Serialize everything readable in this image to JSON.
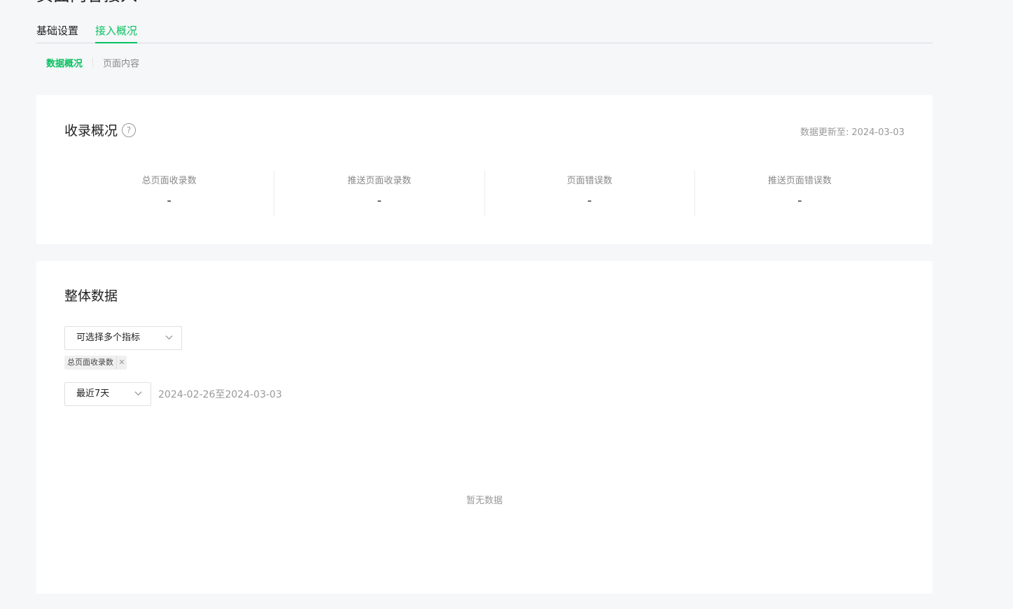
{
  "page": {
    "heading": "页面内容接入"
  },
  "tabs": [
    {
      "label": "基础设置",
      "active": false
    },
    {
      "label": "接入概况",
      "active": true
    }
  ],
  "subtabs": [
    {
      "label": "数据概况",
      "active": true
    },
    {
      "label": "页面内容",
      "active": false
    }
  ],
  "overview": {
    "title": "收录概况",
    "help_icon": "question-circle-icon",
    "update_info": "数据更新至: 2024-03-03",
    "stats": [
      {
        "label": "总页面收录数",
        "value": "-"
      },
      {
        "label": "推送页面收录数",
        "value": "-"
      },
      {
        "label": "页面错误数",
        "value": "-"
      },
      {
        "label": "推送页面错误数",
        "value": "-"
      }
    ]
  },
  "data_section": {
    "title": "整体数据",
    "metric_select": {
      "value": "可选择多个指标"
    },
    "selected_tags": [
      {
        "label": "总页面收录数"
      }
    ],
    "period_select": {
      "value": "最近7天"
    },
    "date_range": "2024-02-26至2024-03-03",
    "empty_text": "暂无数据"
  },
  "colors": {
    "accent": "#07c160",
    "background": "#f6f7f9"
  }
}
